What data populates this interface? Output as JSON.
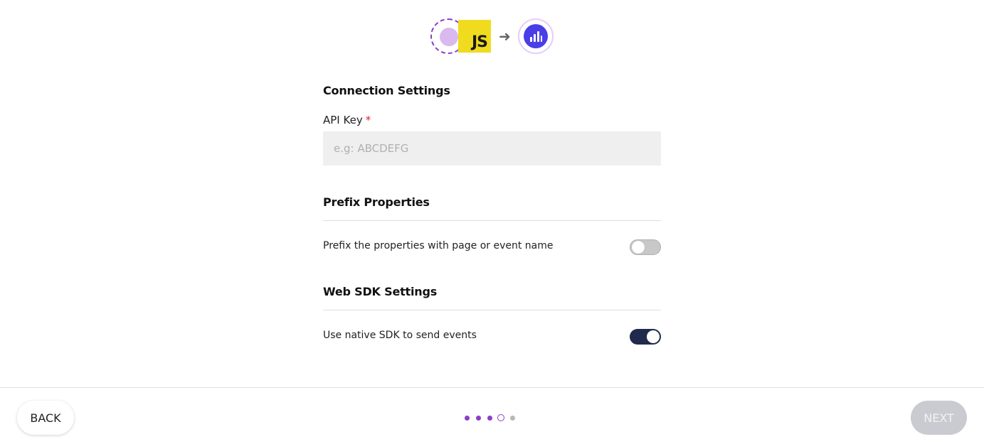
{
  "header": {
    "source_logo_icon": "source-placeholder-icon",
    "js_badge_text": "JS",
    "arrow_icon": "arrow-right-icon",
    "destination_logo_icon": "bar-chart-icon",
    "colors": {
      "accent": "#8a3ec8",
      "js_yellow": "#f0db1f",
      "dest_blue": "#4a3ee6"
    }
  },
  "connection": {
    "title": "Connection Settings",
    "api_key_label": "API Key",
    "required_mark": "*",
    "api_key_value": "",
    "api_key_placeholder": "e.g: ABCDEFG"
  },
  "prefix": {
    "title": "Prefix Properties",
    "option_label": "Prefix the properties with page or event name",
    "option_enabled": false
  },
  "web_sdk": {
    "title": "Web SDK Settings",
    "option_label": "Use native SDK to send events",
    "option_enabled": true,
    "toggle_on_color": "#1f2a4d"
  },
  "footer": {
    "back_label": "BACK",
    "next_label": "NEXT",
    "steps": [
      "done",
      "done",
      "done",
      "current",
      "todo"
    ]
  }
}
